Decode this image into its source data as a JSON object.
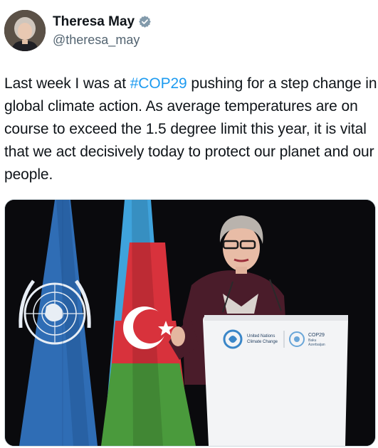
{
  "author": {
    "display_name": "Theresa May",
    "handle": "@theresa_may",
    "verified": true,
    "verified_icon": "verified-badge-icon",
    "avatar_icon": "profile-photo"
  },
  "tweet": {
    "text_before": "Last week I was at ",
    "hashtag": "#COP29",
    "text_after": " pushing for a step change in global climate action. As average temperatures are on course to exceed the 1.5 degree limit this year, it is vital that we act decisively today to protect our planet and our people."
  },
  "media": {
    "podium_left_line1": "United Nations",
    "podium_left_line2": "Climate Change",
    "podium_right_line1": "COP29",
    "podium_right_line2": "Baku",
    "podium_right_line3": "Azerbaijan"
  },
  "colors": {
    "hashtag": "#1d9bf0",
    "verified": "#829aab",
    "un_blue": "#2f6db5",
    "az_blue": "#3fa3dc",
    "az_red": "#d8323c",
    "az_green": "#4a9a3c"
  }
}
